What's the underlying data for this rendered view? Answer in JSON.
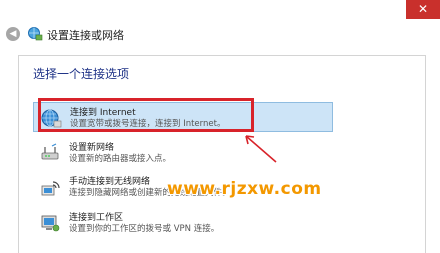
{
  "window": {
    "close_glyph": "✕"
  },
  "nav": {
    "back_glyph": "◀",
    "title": "设置连接或网络"
  },
  "main": {
    "heading": "选择一个连接选项",
    "options": [
      {
        "title": "连接到 Internet",
        "desc": "设置宽带或拨号连接，连接到 Internet。",
        "icon": "globe-network-icon",
        "selected": true
      },
      {
        "title": "设置新网络",
        "desc": "设置新的路由器或接入点。",
        "icon": "router-icon",
        "selected": false
      },
      {
        "title": "手动连接到无线网络",
        "desc": "连接到隐藏网络或创建新的无线配置文件。",
        "icon": "wireless-network-icon",
        "selected": false
      },
      {
        "title": "连接到工作区",
        "desc": "设置到你的工作区的拨号或 VPN 连接。",
        "icon": "workplace-computer-icon",
        "selected": false
      }
    ]
  },
  "watermark": "www.rjzxw.com",
  "colors": {
    "highlight": "#d8232a",
    "close": "#c9302c",
    "heading": "#1e3287",
    "watermark": "#f39800",
    "selected_bg": "#cde4f7"
  }
}
